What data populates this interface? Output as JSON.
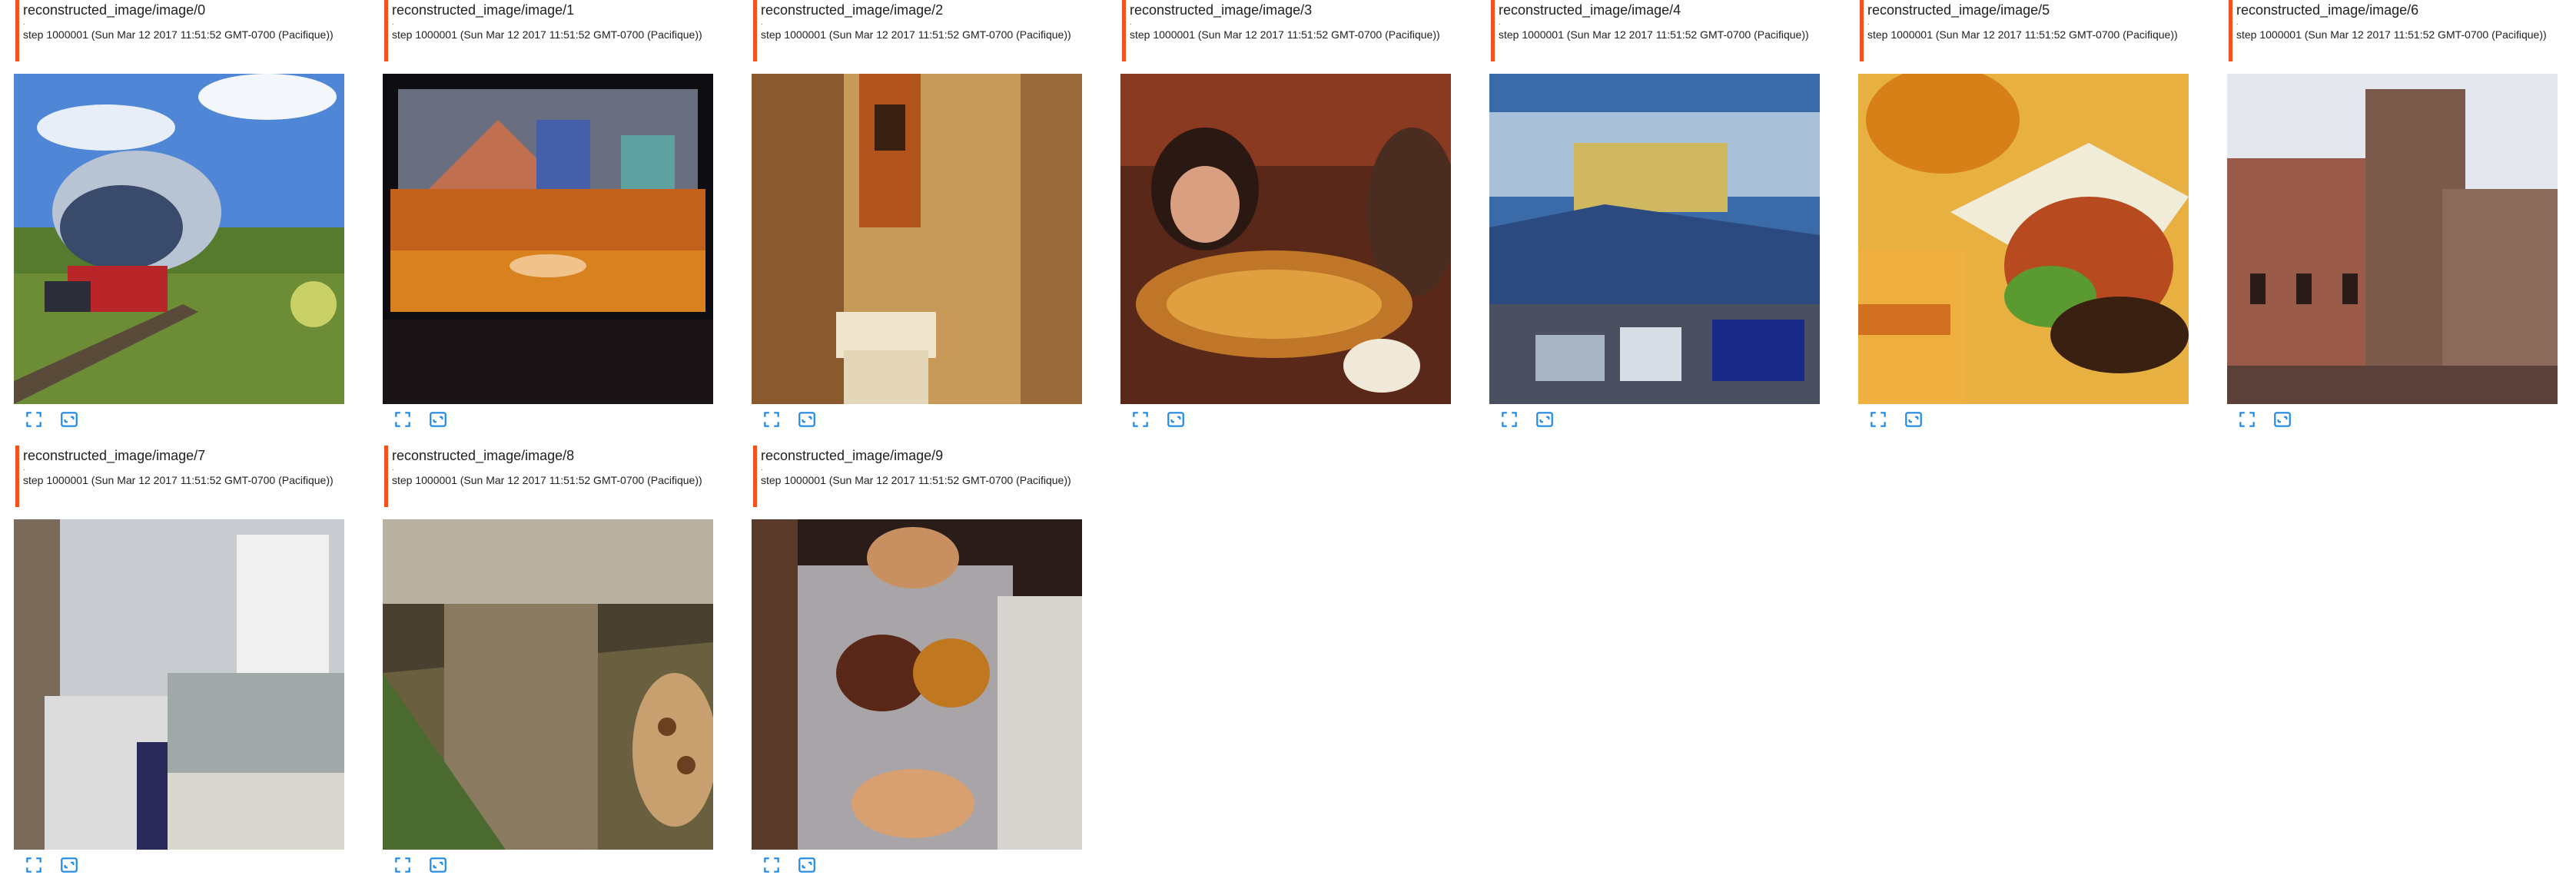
{
  "cards": [
    {
      "title": "reconstructed_image/image/0",
      "dot": ".",
      "step": "step 1000001 (Sun Mar 12 2017 11:51:52 GMT-0700 (Pacifique))",
      "image": "train-on-grass"
    },
    {
      "title": "reconstructed_image/image/1",
      "dot": ".",
      "step": "step 1000001 (Sun Mar 12 2017 11:51:52 GMT-0700 (Pacifique))",
      "image": "orange-couch"
    },
    {
      "title": "reconstructed_image/image/2",
      "dot": ".",
      "step": "step 1000001 (Sun Mar 12 2017 11:51:52 GMT-0700 (Pacifique))",
      "image": "bathroom-toilet"
    },
    {
      "title": "reconstructed_image/image/3",
      "dot": ".",
      "step": "step 1000001 (Sun Mar 12 2017 11:51:52 GMT-0700 (Pacifique))",
      "image": "people-pizza"
    },
    {
      "title": "reconstructed_image/image/4",
      "dot": ".",
      "step": "step 1000001 (Sun Mar 12 2017 11:51:52 GMT-0700 (Pacifique))",
      "image": "trucks-landscape"
    },
    {
      "title": "reconstructed_image/image/5",
      "dot": ".",
      "step": "step 1000001 (Sun Mar 12 2017 11:51:52 GMT-0700 (Pacifique))",
      "image": "burger-fries"
    },
    {
      "title": "reconstructed_image/image/6",
      "dot": ".",
      "step": "step 1000001 (Sun Mar 12 2017 11:51:52 GMT-0700 (Pacifique))",
      "image": "church-tower"
    },
    {
      "title": "reconstructed_image/image/7",
      "dot": ".",
      "step": "step 1000001 (Sun Mar 12 2017 11:51:52 GMT-0700 (Pacifique))",
      "image": "bathroom-sink"
    },
    {
      "title": "reconstructed_image/image/8",
      "dot": ".",
      "step": "step 1000001 (Sun Mar 12 2017 11:51:52 GMT-0700 (Pacifique))",
      "image": "giraffe-tree"
    },
    {
      "title": "reconstructed_image/image/9",
      "dot": ".",
      "step": "step 1000001 (Sun Mar 12 2017 11:51:52 GMT-0700 (Pacifique))",
      "image": "food-table"
    }
  ],
  "icons": {
    "fullscreen": "fullscreen-icon",
    "actual_size": "actual-size-icon"
  },
  "colors": {
    "accent_bar": "#f4511e",
    "icon": "#1e88e5"
  }
}
